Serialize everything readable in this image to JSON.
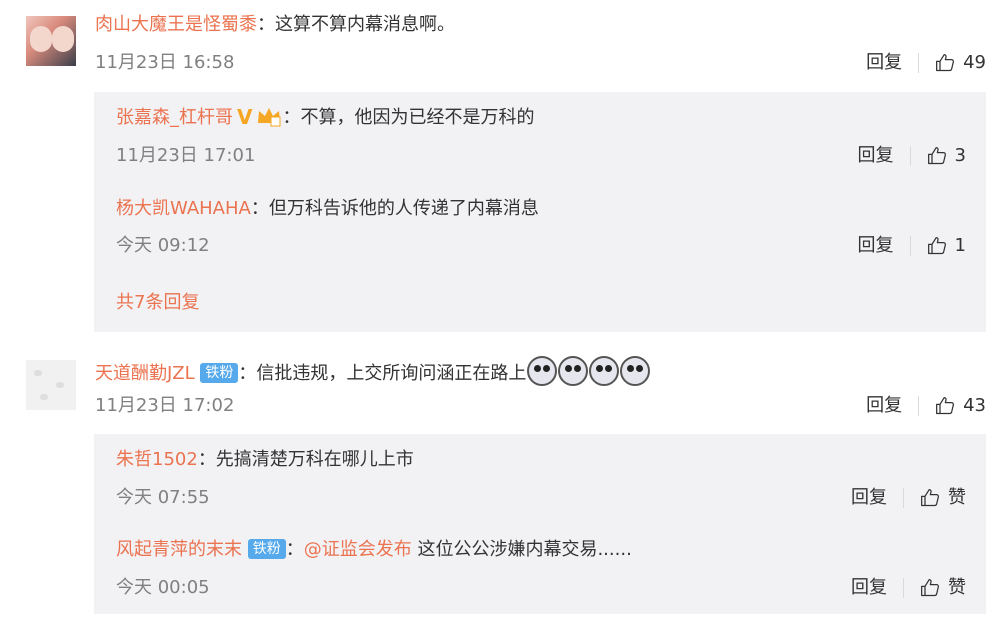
{
  "comments": [
    {
      "author": "肉山大魔王是怪蜀黍",
      "text": "：这算不算内幕消息啊。",
      "time": "11月23日 16:58",
      "reply_label": "回复",
      "likes": "49",
      "replies": [
        {
          "author": "张嘉森_杠杆哥",
          "verified": "V",
          "text": "：不算，他因为已经不是万科的",
          "time": "11月23日 17:01",
          "reply_label": "回复",
          "likes": "3"
        },
        {
          "author": "杨大凯WAHAHA",
          "text": "：但万科告诉他的人传递了内幕消息",
          "time": "今天 09:12",
          "reply_label": "回复",
          "likes": "1"
        }
      ],
      "more_replies": "共7条回复"
    },
    {
      "author": "天道酬勤JZL",
      "badge": "铁粉",
      "text": "：信批违规，上交所询问涵正在路上",
      "time": "11月23日 17:02",
      "reply_label": "回复",
      "likes": "43",
      "replies": [
        {
          "author": "朱哲1502",
          "text": "：先搞清楚万科在哪儿上市",
          "time": "今天 07:55",
          "reply_label": "回复",
          "likes": "赞"
        },
        {
          "author": "风起青萍的末末",
          "badge": "铁粉",
          "text_sep": "：",
          "mention": "@证监会发布",
          "text": " 这位公公涉嫌内幕交易......",
          "time": "今天 00:05",
          "reply_label": "回复",
          "likes": "赞"
        }
      ]
    }
  ],
  "colors": {
    "name": "#eb7350",
    "badge": "#56a9eb",
    "reply_bg": "#f2f2f5",
    "meta": "#808080"
  },
  "icons": {
    "like": "thumbs-up-icon",
    "vip": "crown-icon",
    "emoji": "doge-emoji-icon"
  }
}
